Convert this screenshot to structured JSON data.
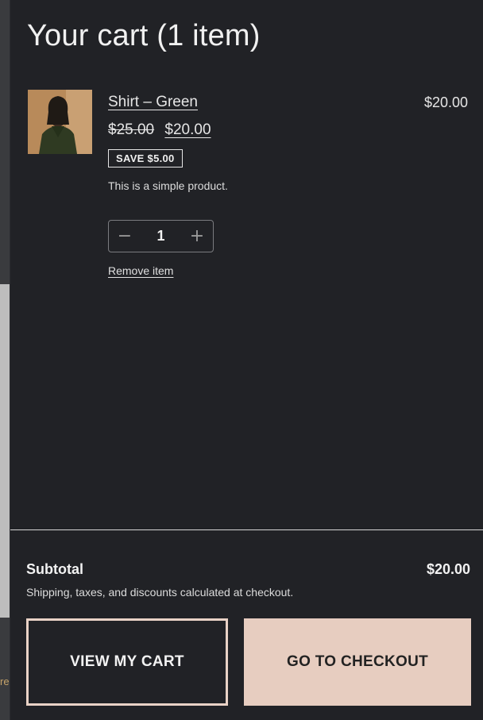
{
  "cart": {
    "title": "Your cart (1 item)",
    "item": {
      "name": "Shirt – Green",
      "line_price": "$20.00",
      "original_price": "$25.00",
      "sale_price": "$20.00",
      "save_badge": "SAVE $5.00",
      "description": "This is a simple product.",
      "quantity": "1",
      "decrement_symbol": "−",
      "increment_symbol": "+",
      "remove_label": "Remove item",
      "image_icon": "product-photo"
    },
    "subtotal_label": "Subtotal",
    "subtotal_value": "$20.00",
    "shipping_note": "Shipping, taxes, and discounts calculated at checkout.",
    "view_cart_label": "VIEW MY CART",
    "checkout_label": "GO TO CHECKOUT"
  },
  "background": {
    "peek_text": "re"
  },
  "colors": {
    "drawer_bg": "#212226",
    "accent": "#e7cdc0"
  }
}
